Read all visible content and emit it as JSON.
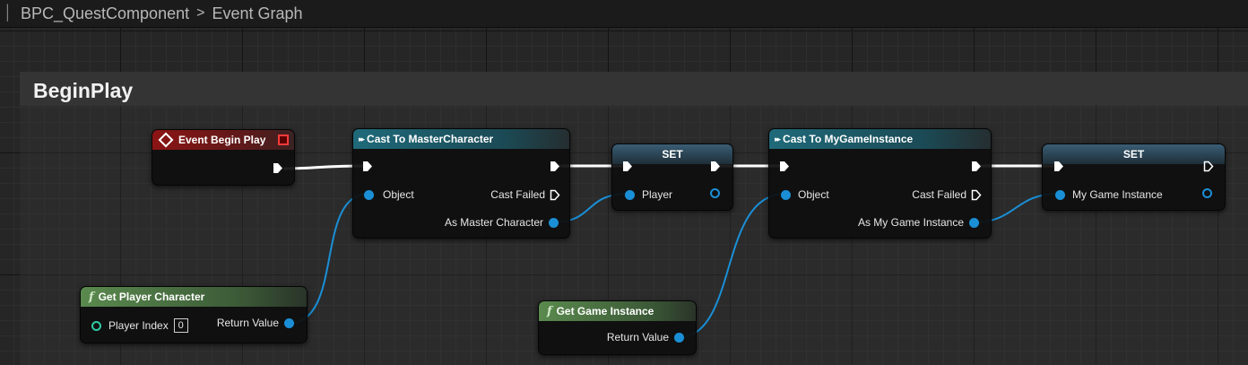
{
  "breadcrumb": {
    "component": "BPC_QuestComponent",
    "graph": "Event Graph"
  },
  "comment": {
    "title": "BeginPlay"
  },
  "nodes": {
    "event_begin_play": {
      "title": "Event Begin Play"
    },
    "cast_master": {
      "title": "Cast To MasterCharacter",
      "object_label": "Object",
      "cast_failed_label": "Cast Failed",
      "as_label": "As Master Character"
    },
    "set_player": {
      "title": "SET",
      "var_label": "Player"
    },
    "cast_game_instance": {
      "title": "Cast To MyGameInstance",
      "object_label": "Object",
      "cast_failed_label": "Cast Failed",
      "as_label": "As My Game Instance"
    },
    "set_game_instance": {
      "title": "SET",
      "var_label": "My Game Instance"
    },
    "get_player_character": {
      "title": "Get Player Character",
      "player_index_label": "Player Index",
      "player_index_value": "0",
      "return_label": "Return Value"
    },
    "get_game_instance": {
      "title": "Get Game Instance",
      "return_label": "Return Value"
    }
  },
  "colors": {
    "exec_wire": "#ffffff",
    "object_wire": "#1a8fd6",
    "event_header": "#8c1414",
    "cast_header": "#1f6a7a",
    "func_header": "#5a8a4e",
    "set_header": "#3a5d74"
  },
  "icons": {
    "event": "event-diamond-icon",
    "cast": "exec-arrows-icon",
    "function": "function-f-icon"
  }
}
